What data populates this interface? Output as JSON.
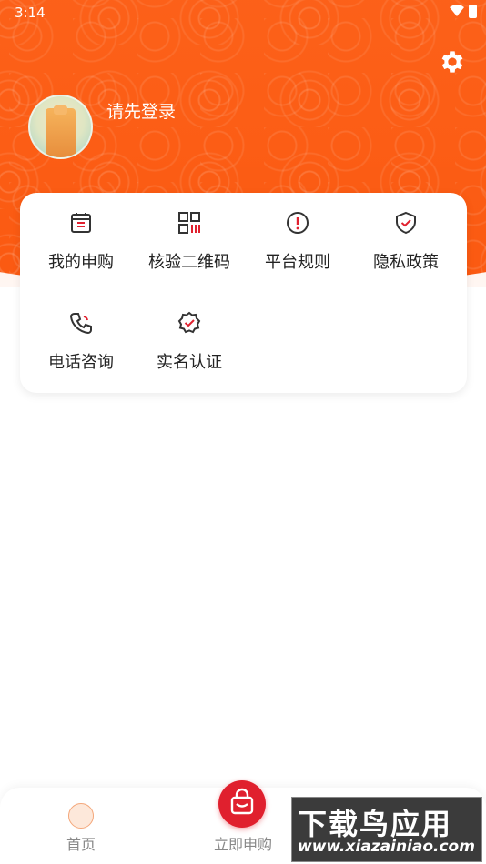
{
  "status_bar": {
    "time": "3:14"
  },
  "header": {
    "login_prompt": "请先登录",
    "settings_icon": "gear-icon",
    "avatar_icon": "user-avatar"
  },
  "menu": {
    "items": [
      {
        "label": "我的申购",
        "icon": "calendar-icon"
      },
      {
        "label": "核验二维码",
        "icon": "qr-code-icon"
      },
      {
        "label": "平台规则",
        "icon": "alert-circle-icon"
      },
      {
        "label": "隐私政策",
        "icon": "shield-check-icon"
      },
      {
        "label": "电话咨询",
        "icon": "phone-icon"
      },
      {
        "label": "实名认证",
        "icon": "verified-badge-icon"
      }
    ]
  },
  "tab_bar": {
    "tabs": [
      {
        "label": "首页",
        "icon": "home-icon"
      },
      {
        "label": "立即申购",
        "icon": "shopping-bag-icon"
      }
    ]
  },
  "watermark": {
    "title": "下载鸟应用",
    "url": "www.xiazainiao.com"
  },
  "colors": {
    "brand_orange": "#fb5a12",
    "accent_red": "#e0202e"
  }
}
